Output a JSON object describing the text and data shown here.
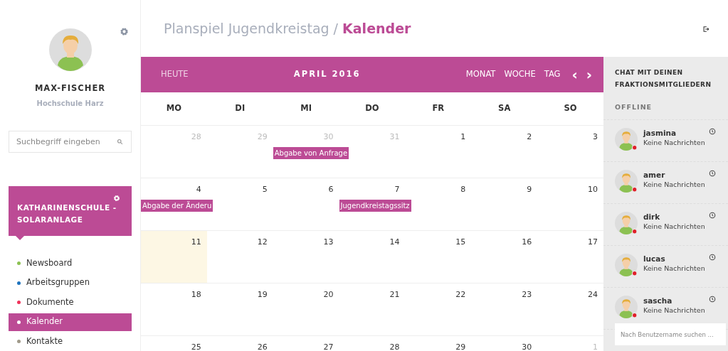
{
  "profile": {
    "name": "MAX-FISCHER",
    "school": "Hochschule Harz"
  },
  "search": {
    "placeholder": "Suchbegriff eingeben"
  },
  "project": {
    "title": "KATHARINENSCHULE - SOLARANLAGE"
  },
  "nav": [
    {
      "label": "Newsboard",
      "color": "#8cc152",
      "selected": false
    },
    {
      "label": "Arbeitsgruppen",
      "color": "#1e73be",
      "selected": false
    },
    {
      "label": "Dokumente",
      "color": "#f0325a",
      "selected": false
    },
    {
      "label": "Kalender",
      "color": "#ffffff",
      "selected": true
    },
    {
      "label": "Kontakte",
      "color": "#a09a8a",
      "selected": false
    }
  ],
  "breadcrumb": {
    "parent": "Planspiel Jugendkreistag /",
    "current": "Kalender"
  },
  "calendar": {
    "today_button": "HEUTE",
    "title": "APRIL 2016",
    "views": [
      {
        "label": "MONAT"
      },
      {
        "label": "WOCHE"
      },
      {
        "label": "TAG"
      }
    ],
    "prev": "‹",
    "next": "›",
    "weekdays": [
      "MO",
      "DI",
      "MI",
      "DO",
      "FR",
      "SA",
      "SO"
    ],
    "weeks": [
      [
        {
          "day": "28",
          "muted": true,
          "today": false
        },
        {
          "day": "29",
          "muted": true,
          "today": false
        },
        {
          "day": "30",
          "muted": true,
          "today": false,
          "events": [
            {
              "title": "Abgabe von Anfrage"
            }
          ]
        },
        {
          "day": "31",
          "muted": true,
          "today": false
        },
        {
          "day": "1",
          "muted": false,
          "today": false
        },
        {
          "day": "2",
          "muted": false,
          "today": false
        },
        {
          "day": "3",
          "muted": false,
          "today": false
        }
      ],
      [
        {
          "day": "4",
          "muted": false,
          "today": false,
          "events": [
            {
              "title": "Abgabe der Änderu"
            }
          ]
        },
        {
          "day": "5",
          "muted": false,
          "today": false
        },
        {
          "day": "6",
          "muted": false,
          "today": false
        },
        {
          "day": "7",
          "muted": false,
          "today": false,
          "events": [
            {
              "title": "Jugendkreistagssitz"
            }
          ]
        },
        {
          "day": "8",
          "muted": false,
          "today": false
        },
        {
          "day": "9",
          "muted": false,
          "today": false
        },
        {
          "day": "10",
          "muted": false,
          "today": false
        }
      ],
      [
        {
          "day": "11",
          "muted": false,
          "today": true
        },
        {
          "day": "12",
          "muted": false,
          "today": false
        },
        {
          "day": "13",
          "muted": false,
          "today": false
        },
        {
          "day": "14",
          "muted": false,
          "today": false
        },
        {
          "day": "15",
          "muted": false,
          "today": false
        },
        {
          "day": "16",
          "muted": false,
          "today": false
        },
        {
          "day": "17",
          "muted": false,
          "today": false
        }
      ],
      [
        {
          "day": "18",
          "muted": false,
          "today": false
        },
        {
          "day": "19",
          "muted": false,
          "today": false
        },
        {
          "day": "20",
          "muted": false,
          "today": false
        },
        {
          "day": "21",
          "muted": false,
          "today": false
        },
        {
          "day": "22",
          "muted": false,
          "today": false
        },
        {
          "day": "23",
          "muted": false,
          "today": false
        },
        {
          "day": "24",
          "muted": false,
          "today": false
        }
      ],
      [
        {
          "day": "25",
          "muted": false,
          "today": false
        },
        {
          "day": "26",
          "muted": false,
          "today": false
        },
        {
          "day": "27",
          "muted": false,
          "today": false
        },
        {
          "day": "28",
          "muted": false,
          "today": false
        },
        {
          "day": "29",
          "muted": false,
          "today": false
        },
        {
          "day": "30",
          "muted": false,
          "today": false
        },
        {
          "day": "1",
          "muted": true,
          "today": false
        }
      ]
    ]
  },
  "chat": {
    "title": "CHAT MIT DEINEN FRAKTIONSMITGLIEDERN",
    "section": "OFFLINE",
    "users": [
      {
        "name": "jasmina",
        "status": "Keine Nachrichten"
      },
      {
        "name": "amer",
        "status": "Keine Nachrichten"
      },
      {
        "name": "dirk",
        "status": "Keine Nachrichten"
      },
      {
        "name": "lucas",
        "status": "Keine Nachrichten"
      },
      {
        "name": "sascha",
        "status": "Keine Nachrichten"
      }
    ],
    "search": {
      "placeholder": "Nach Benutzername suchen ..."
    }
  }
}
